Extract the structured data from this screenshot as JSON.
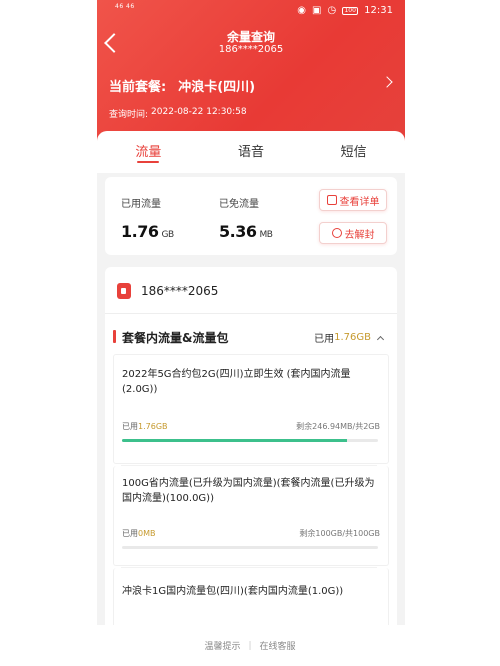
{
  "status_bar": {
    "left_text": "46 46",
    "time": "12:31",
    "battery": "100"
  },
  "header": {
    "title": "余量查询",
    "phone_number": "186****2065",
    "plan_label": "当前套餐:",
    "plan_name": "冲浪卡(四川)",
    "query_time_label": "查询时间:",
    "query_time": "2022-08-22 12:30:58"
  },
  "tabs": [
    {
      "label": "流量",
      "active": true
    },
    {
      "label": "语音",
      "active": false
    },
    {
      "label": "短信",
      "active": false
    }
  ],
  "usage": {
    "used_label": "已用流量",
    "used_value": "1.76",
    "used_unit": "GB",
    "free_label": "已免流量",
    "free_value": "5.36",
    "free_unit": "MB",
    "details_button": "查看详单",
    "unblock_button": "去解封"
  },
  "detail": {
    "phone_number": "186****2065",
    "section_title": "套餐内流量&流量包",
    "section_used_label": "已用",
    "section_used_value": "1.76GB",
    "packages": [
      {
        "name": "2022年5G合约包2G(四川)立即生效 (套内国内流量(2.0G))",
        "used_label": "已用",
        "used_value": "1.76GB",
        "remaining": "剩余246.94MB/共2GB",
        "progress": 0.88
      },
      {
        "name": "100G省内流量(已升级为国内流量)(套餐内流量(已升级为国内流量)(100.0G))",
        "used_label": "已用",
        "used_value": "0MB",
        "remaining": "剩余100GB/共100GB",
        "progress": 0.0
      },
      {
        "name": "冲浪卡1G国内流量包(四川)(套内国内流量(1.0G))"
      }
    ]
  },
  "footer": {
    "tip": "温馨提示",
    "service": "在线客服"
  }
}
